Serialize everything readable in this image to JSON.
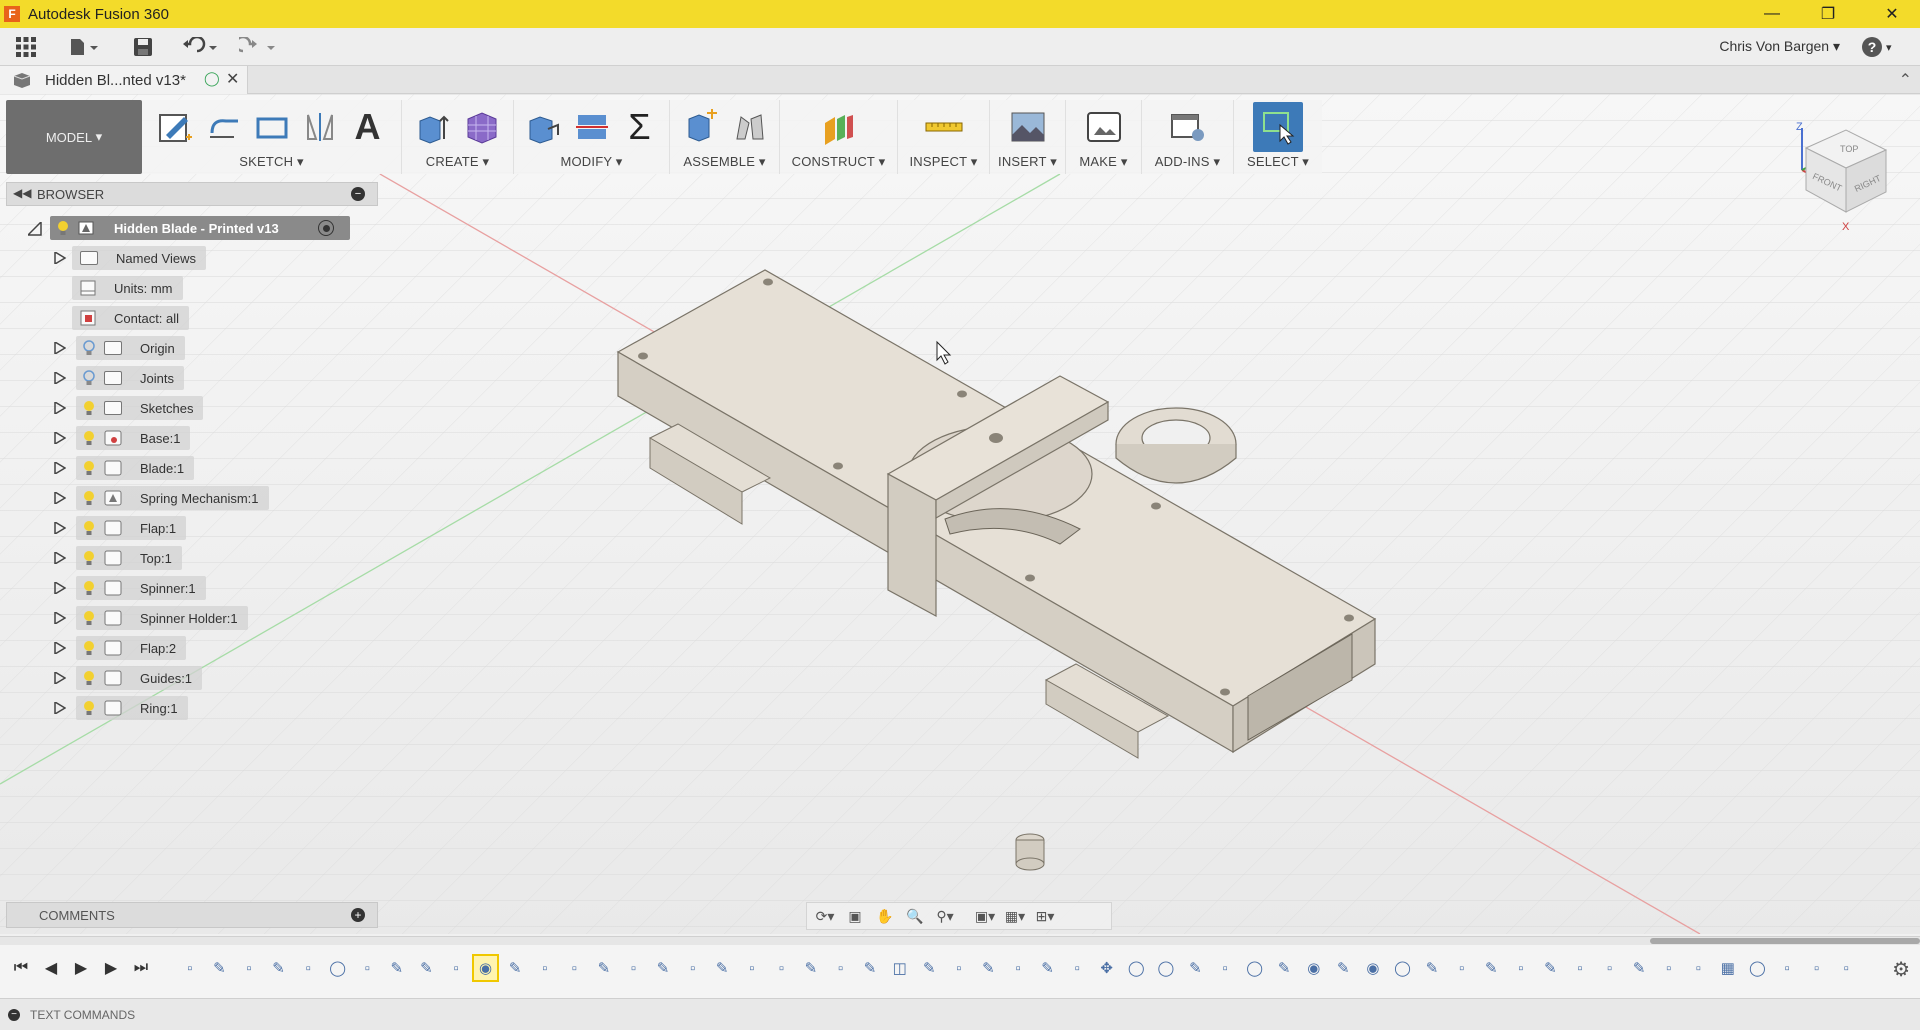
{
  "window": {
    "app_title": "Autodesk Fusion 360",
    "logo_letter": "F"
  },
  "quickbar": {
    "user_name": "Chris Von Bargen",
    "help_glyph": "?"
  },
  "document_tab": {
    "title": "Hidden Bl...nted v13*"
  },
  "toolbar": {
    "workspace": "MODEL",
    "groups": [
      {
        "label": "SKETCH"
      },
      {
        "label": "CREATE"
      },
      {
        "label": "MODIFY"
      },
      {
        "label": "ASSEMBLE"
      },
      {
        "label": "CONSTRUCT"
      },
      {
        "label": "INSPECT"
      },
      {
        "label": "INSERT"
      },
      {
        "label": "MAKE"
      },
      {
        "label": "ADD-INS"
      },
      {
        "label": "SELECT"
      }
    ],
    "text_tool_glyph": "A",
    "sum_glyph": "Σ"
  },
  "browser": {
    "title": "BROWSER",
    "root": "Hidden Blade - Printed v13",
    "items": [
      {
        "label": "Named Views"
      },
      {
        "label": "Units: mm"
      },
      {
        "label": "Contact: all"
      },
      {
        "label": "Origin"
      },
      {
        "label": "Joints"
      },
      {
        "label": "Sketches"
      },
      {
        "label": "Base:1"
      },
      {
        "label": "Blade:1"
      },
      {
        "label": "Spring Mechanism:1"
      },
      {
        "label": "Flap:1"
      },
      {
        "label": "Top:1"
      },
      {
        "label": "Spinner:1"
      },
      {
        "label": "Spinner Holder:1"
      },
      {
        "label": "Flap:2"
      },
      {
        "label": "Guides:1"
      },
      {
        "label": "Ring:1"
      }
    ]
  },
  "comments": {
    "title": "COMMENTS"
  },
  "text_commands": {
    "label": "TEXT COMMANDS"
  },
  "viewcube": {
    "top": "TOP",
    "front": "FRONT",
    "right": "RIGHT",
    "axis_z": "Z",
    "axis_x": "X"
  },
  "colors": {
    "titlebar": "#f3db2a",
    "model_part": "#e6e0d6",
    "select_blue": "#3d7ab8"
  }
}
